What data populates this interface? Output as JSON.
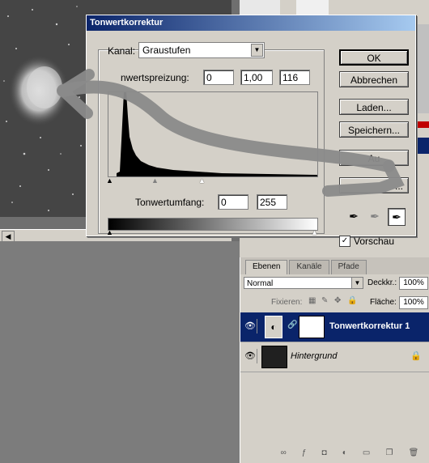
{
  "dialog": {
    "title": "Tonwertkorrektur",
    "channel_label": "Kanal:",
    "channel_value": "Graustufen",
    "input_levels_label": "nwertspreizung:",
    "input_levels": [
      "0",
      "1,00",
      "116"
    ],
    "output_levels_label": "Tonwertumfang:",
    "output_levels": [
      "0",
      "255"
    ],
    "buttons": {
      "ok": "OK",
      "cancel": "Abbrechen",
      "load": "Laden...",
      "save": "Speichern...",
      "auto": "Au",
      "options": "..."
    },
    "preview_label": "Vorschau",
    "preview_checked": true
  },
  "layers_panel": {
    "tabs": [
      "Ebenen",
      "Kanäle",
      "Pfade"
    ],
    "blend_mode": "Normal",
    "opacity_label": "Deckkr.:",
    "opacity_value": "100%",
    "lock_label": "Fixieren:",
    "fill_label": "Fläche:",
    "fill_value": "100%",
    "layers": [
      {
        "name": "Tonwertkorrektur 1",
        "selected": true
      },
      {
        "name": "Hintergrund",
        "selected": false
      }
    ]
  },
  "colors": {
    "titlebar_start": "#0a246a",
    "titlebar_end": "#a6caf0",
    "selected_layer": "#0a246a",
    "annotation_arrow": "#8a8a8a"
  }
}
